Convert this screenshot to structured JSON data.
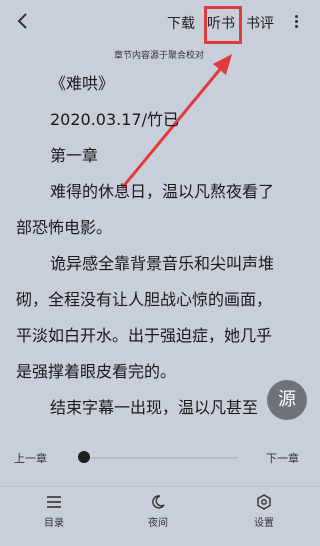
{
  "toolbar": {
    "download_label": "下载",
    "listen_label": "听书",
    "review_label": "书评"
  },
  "source_note": "章节内容源于聚合校对",
  "content": {
    "lines": [
      "《难哄》",
      "2020.03.17/竹已",
      "第一章",
      "难得的休息日，温以凡熬夜看了",
      "部恐怖电影。",
      "诡异感全靠背景音乐和尖叫声堆",
      "砌，全程没有让人胆战心惊的画面，",
      "平淡如白开水。出于强迫症，她几乎",
      "是强撑着眼皮看完的。",
      "结束字幕一出现，温以凡甚至"
    ]
  },
  "fab_label": "源",
  "progress": {
    "prev_label": "上一章",
    "next_label": "下一章",
    "value": 0
  },
  "bottom_nav": {
    "catalog_label": "目录",
    "night_label": "夜间",
    "settings_label": "设置"
  },
  "colors": {
    "background": "#c9cedb",
    "highlight": "#e03b3b",
    "fab": "#6e737b"
  }
}
